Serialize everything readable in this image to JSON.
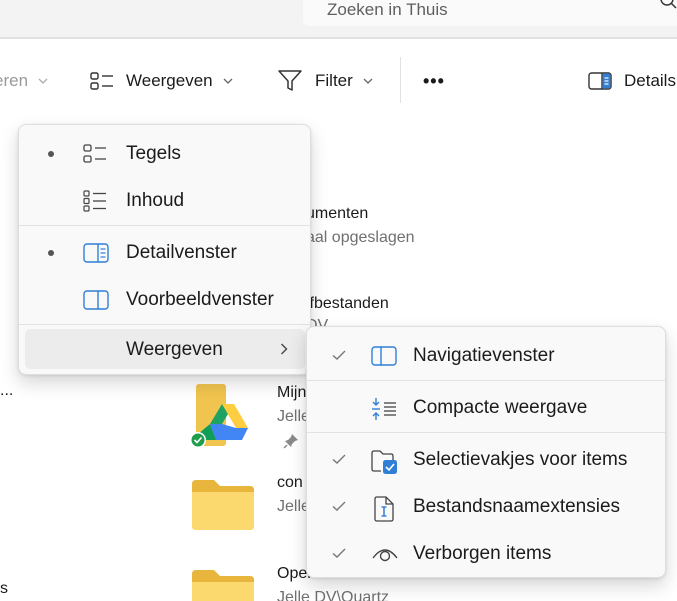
{
  "search": {
    "placeholder": "Zoeken in Thuis"
  },
  "commandbar": {
    "sort_label": "eren",
    "view_label": "Weergeven",
    "filter_label": "Filter",
    "more_label": "•••",
    "details_label": "Details"
  },
  "background_items": {
    "documents_name": "umenten",
    "documents_sub": "aal opgeslagen",
    "writefiles_name": "jfbestanden",
    "writefiles_sub": "DV",
    "left_ellipsis": "...",
    "mydrive_name": "Mijn",
    "mydrive_sub": "Jelle",
    "con_name": "con",
    "con_sub": "Jelle",
    "openbrein_name": "Openbrein",
    "openbrein_sub": "Jelle DV\\Quartz",
    "left_item_bottom": "s"
  },
  "view_menu": {
    "items": [
      {
        "label": "Tegels",
        "selected": true,
        "icon": "tiles-icon"
      },
      {
        "label": "Inhoud",
        "selected": false,
        "icon": "content-list-icon"
      },
      {
        "label": "Detailvenster",
        "selected": true,
        "icon": "details-pane-icon"
      },
      {
        "label": "Voorbeeldvenster",
        "selected": false,
        "icon": "preview-pane-icon"
      },
      {
        "label": "Weergeven",
        "has_submenu": true
      }
    ]
  },
  "show_submenu": {
    "items": [
      {
        "label": "Navigatievenster",
        "checked": true,
        "icon": "navigation-pane-icon"
      },
      {
        "label": "Compacte weergave",
        "checked": false,
        "icon": "compact-view-icon"
      },
      {
        "label": "Selectievakjes voor items",
        "checked": true,
        "icon": "checkbox-items-icon"
      },
      {
        "label": "Bestandsnaamextensies",
        "checked": true,
        "icon": "file-extension-icon"
      },
      {
        "label": "Verborgen items",
        "checked": true,
        "icon": "hidden-items-icon"
      }
    ]
  },
  "colors": {
    "accent": "#005fb8",
    "menu_bg": "#f9f9f9",
    "folder": "#f8d775"
  }
}
